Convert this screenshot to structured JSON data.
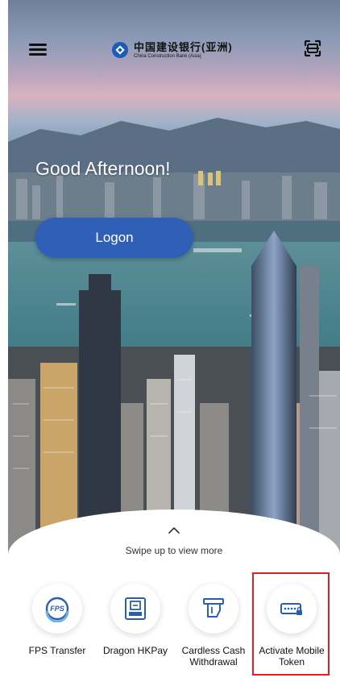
{
  "header": {
    "brand_cn": "中国建设银行(亚洲)",
    "brand_en": "China Construction Bank (Asia)",
    "menu_icon": "hamburger-menu-icon",
    "scan_icon": "scan-icon"
  },
  "hero": {
    "greeting": "Good Afternoon!",
    "logon_label": "Logon"
  },
  "sheet": {
    "swipe_text": "Swipe up to view more",
    "shortcuts": [
      {
        "label": "FPS Transfer",
        "icon": "fps-icon"
      },
      {
        "label": "Dragon HKPay",
        "icon": "dragon-pay-icon"
      },
      {
        "label": "Cardless Cash Withdrawal",
        "icon": "cardless-cash-icon"
      },
      {
        "label": "Activate Mobile Token",
        "icon": "mobile-token-icon"
      }
    ]
  },
  "colors": {
    "primary": "#2f5fb6",
    "logo_blue": "#1d5bb8",
    "icon_blue": "#2a5eb1",
    "highlight": "#e02020"
  }
}
